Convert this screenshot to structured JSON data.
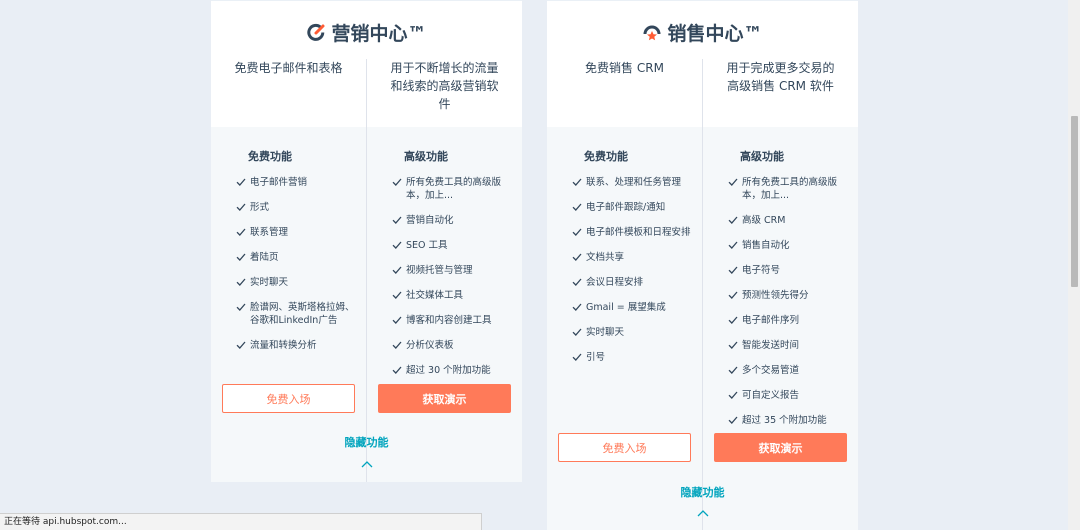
{
  "marketing": {
    "title": "营销中心™",
    "free_desc": "免费电子邮件和表格",
    "pro_desc": "用于不断增长的流量和线索的高级营销软件",
    "free_heading": "免费功能",
    "pro_heading": "高级功能",
    "free_features": [
      "电子邮件营销",
      "形式",
      "联系管理",
      "着陆页",
      "实时聊天",
      "脸谱网、英斯塔格拉姆、谷歌和LinkedIn广告",
      "流量和转换分析"
    ],
    "pro_features": [
      "所有免费工具的高级版本，加上...",
      "营销自动化",
      "SEO 工具",
      "视频托管与管理",
      "社交媒体工具",
      "博客和内容创建工具",
      "分析仪表板",
      "超过 30 个附加功能"
    ],
    "free_button": "免费入场",
    "pro_button": "获取演示",
    "hide_link": "隐藏功能"
  },
  "sales": {
    "title": "销售中心™",
    "free_desc": "免费销售 CRM",
    "pro_desc": "用于完成更多交易的高级销售 CRM 软件",
    "free_heading": "免费功能",
    "pro_heading": "高级功能",
    "free_features": [
      "联系、处理和任务管理",
      "电子邮件跟踪/通知",
      "电子邮件模板和日程安排",
      "文档共享",
      "会议日程安排",
      "Gmail = 展望集成",
      "实时聊天",
      "引号"
    ],
    "pro_features": [
      "所有免费工具的高级版本，加上...",
      "高级 CRM",
      "销售自动化",
      "电子符号",
      "预测性领先得分",
      "电子邮件序列",
      "智能发送时间",
      "多个交易管道",
      "可自定义报告",
      "超过 35 个附加功能"
    ],
    "free_button": "免费入场",
    "pro_button": "获取演示",
    "hide_link": "隐藏功能"
  },
  "status_bar": {
    "text": "正在等待 api.hubspot.com..."
  },
  "colors": {
    "accent": "#ff7a59",
    "link": "#00a4bd",
    "text": "#33475b",
    "panel": "#f5f8fa"
  },
  "icons": {
    "marketing_logo": "marketing-hub-icon",
    "sales_logo": "sales-hub-icon",
    "check": "check-icon",
    "chevron": "chevron-up-icon"
  }
}
